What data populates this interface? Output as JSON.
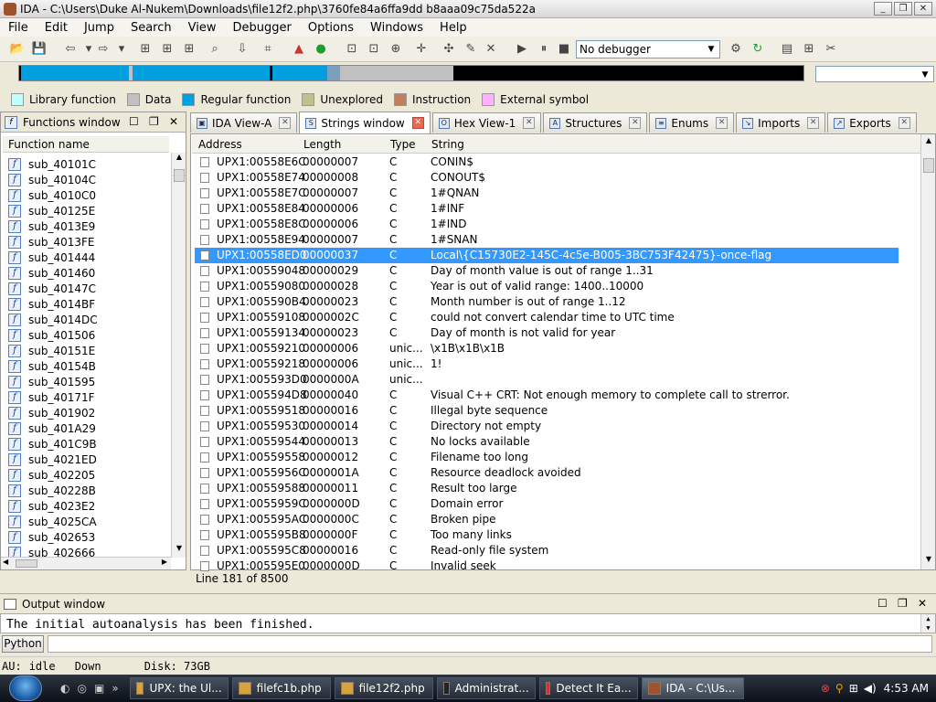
{
  "window": {
    "title": "IDA - C:\\Users\\Duke Al-Nukem\\Downloads\\file12f2.php\\3760fe84a6ffa9dd b8aaa09c75da522a"
  },
  "menu": [
    "File",
    "Edit",
    "Jump",
    "Search",
    "View",
    "Debugger",
    "Options",
    "Windows",
    "Help"
  ],
  "toolbar": {
    "debugger_value": "No debugger"
  },
  "legend": [
    {
      "label": "Library function",
      "color": "#c0ffff"
    },
    {
      "label": "Data",
      "color": "#c0c0c0"
    },
    {
      "label": "Regular function",
      "color": "#00a0e0"
    },
    {
      "label": "Unexplored",
      "color": "#c0c08a"
    },
    {
      "label": "Instruction",
      "color": "#c08060"
    },
    {
      "label": "External symbol",
      "color": "#ffb0ff"
    }
  ],
  "functions": {
    "title": "Functions window",
    "column": "Function name",
    "items": [
      "sub_40101C",
      "sub_40104C",
      "sub_4010C0",
      "sub_40125E",
      "sub_4013E9",
      "sub_4013FE",
      "sub_401444",
      "sub_401460",
      "sub_40147C",
      "sub_4014BF",
      "sub_4014DC",
      "sub_401506",
      "sub_40151E",
      "sub_40154B",
      "sub_401595",
      "sub_40171F",
      "sub_401902",
      "sub_401A29",
      "sub_401C9B",
      "sub_4021ED",
      "sub_402205",
      "sub_40228B",
      "sub_4023E2",
      "sub_4025CA",
      "sub_402653",
      "sub_402666"
    ]
  },
  "tabs": [
    {
      "label": "IDA View-A",
      "active": false
    },
    {
      "label": "Strings window",
      "active": true
    },
    {
      "label": "Hex View-1",
      "active": false
    },
    {
      "label": "Structures",
      "active": false
    },
    {
      "label": "Enums",
      "active": false
    },
    {
      "label": "Imports",
      "active": false
    },
    {
      "label": "Exports",
      "active": false
    }
  ],
  "strings": {
    "columns": [
      "Address",
      "Length",
      "Type",
      "String"
    ],
    "rows": [
      [
        "UPX1:00558E6C",
        "00000007",
        "C",
        "CONIN$"
      ],
      [
        "UPX1:00558E74",
        "00000008",
        "C",
        "CONOUT$"
      ],
      [
        "UPX1:00558E7C",
        "00000007",
        "C",
        "1#QNAN"
      ],
      [
        "UPX1:00558E84",
        "00000006",
        "C",
        "1#INF"
      ],
      [
        "UPX1:00558E8C",
        "00000006",
        "C",
        "1#IND"
      ],
      [
        "UPX1:00558E94",
        "00000007",
        "C",
        "1#SNAN"
      ],
      [
        "UPX1:00558ED0",
        "00000037",
        "C",
        "Local\\{C15730E2-145C-4c5e-B005-3BC753F42475}-once-flag"
      ],
      [
        "UPX1:00559048",
        "00000029",
        "C",
        "Day of month value is out of range 1..31"
      ],
      [
        "UPX1:00559080",
        "00000028",
        "C",
        "Year is out of valid range: 1400..10000"
      ],
      [
        "UPX1:005590B4",
        "00000023",
        "C",
        "Month number is out of range 1..12"
      ],
      [
        "UPX1:00559108",
        "0000002C",
        "C",
        "could not convert calendar time to UTC time"
      ],
      [
        "UPX1:00559134",
        "00000023",
        "C",
        "Day of month is not valid for year"
      ],
      [
        "UPX1:00559210",
        "00000006",
        "unic...",
        "\\x1B\\x1B\\x1B"
      ],
      [
        "UPX1:00559218",
        "00000006",
        "unic...",
        "1!"
      ],
      [
        "UPX1:005593D0",
        "0000000A",
        "unic...",
        ""
      ],
      [
        "UPX1:005594D8",
        "00000040",
        "C",
        "Visual C++ CRT: Not enough memory to complete call to strerror."
      ],
      [
        "UPX1:00559518",
        "00000016",
        "C",
        "Illegal byte sequence"
      ],
      [
        "UPX1:00559530",
        "00000014",
        "C",
        "Directory not empty"
      ],
      [
        "UPX1:00559544",
        "00000013",
        "C",
        "No locks available"
      ],
      [
        "UPX1:00559558",
        "00000012",
        "C",
        "Filename too long"
      ],
      [
        "UPX1:0055956C",
        "0000001A",
        "C",
        "Resource deadlock avoided"
      ],
      [
        "UPX1:00559588",
        "00000011",
        "C",
        "Result too large"
      ],
      [
        "UPX1:0055959C",
        "0000000D",
        "C",
        "Domain error"
      ],
      [
        "UPX1:005595AC",
        "0000000C",
        "C",
        "Broken pipe"
      ],
      [
        "UPX1:005595B8",
        "0000000F",
        "C",
        "Too many links"
      ],
      [
        "UPX1:005595C8",
        "00000016",
        "C",
        "Read-only file system"
      ],
      [
        "UPX1:005595E0",
        "0000000D",
        "C",
        "Invalid seek"
      ]
    ],
    "selected_index": 6,
    "status": "Line 181 of 8500"
  },
  "output": {
    "title": "Output window",
    "text": "The initial autoanalysis has been finished.",
    "python_label": "Python"
  },
  "statusbar": {
    "au_label": "AU:",
    "au_value": "idle",
    "direction": "Down",
    "disk": "Disk: 73GB"
  },
  "taskbar": {
    "items": [
      {
        "label": "UPX: the Ul...",
        "active": false
      },
      {
        "label": "filefc1b.php",
        "active": false
      },
      {
        "label": "file12f2.php",
        "active": false
      },
      {
        "label": "Administrat...",
        "active": false
      },
      {
        "label": "Detect It Ea...",
        "active": false
      },
      {
        "label": "IDA - C:\\Us...",
        "active": true
      }
    ],
    "time": "4:53 AM"
  }
}
